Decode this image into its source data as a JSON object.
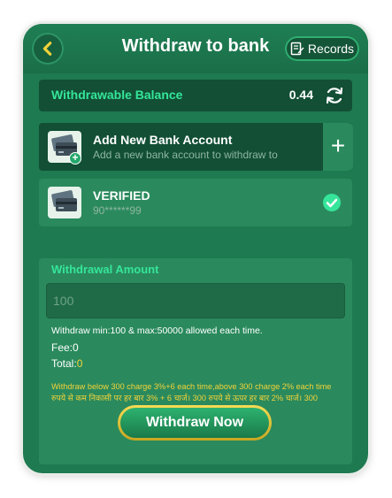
{
  "header": {
    "title": "Withdraw to bank",
    "records_label": "Records",
    "back_icon": "chevron-left-icon",
    "records_icon": "edit-document-icon"
  },
  "balance": {
    "label": "Withdrawable Balance",
    "value": "0.44",
    "icon": "refresh-icon"
  },
  "add_account": {
    "title": "Add New Bank Account",
    "subtitle": "Add a new bank account to withdraw to",
    "button": "+"
  },
  "verified_account": {
    "title": "VERIFIED",
    "number": "90******99",
    "icon": "check-circle-icon"
  },
  "amount": {
    "title": "Withdrawal Amount",
    "input_placeholder": "100",
    "rule": "Withdraw min:100 & max:50000 allowed each time.",
    "fee": "Fee:0",
    "total_label": "Total:",
    "total_value": "0",
    "notice": "Withdraw below 300 charge 3%+6 each time,above 300 charge 2% each time रुपये से कम निकासी पर हर बार 3% + 6 चार्ज। 300 रुपये से ऊपर हर बार 2% चार्ज। 300",
    "notice_line1": "Withdraw below 300 charge 3%+6 each time,above 300 charge 2% each time",
    "notice_line2": "रुपये से कम निकासी पर हर बार 3% + 6 चार्ज। 300 रुपये से ऊपर हर बार 2% चार्ज। 300",
    "submit_label": "Withdraw Now"
  },
  "colors": {
    "background": "#1e7a50",
    "accent_green": "#35e59a",
    "accent_yellow": "#f3d23a"
  }
}
